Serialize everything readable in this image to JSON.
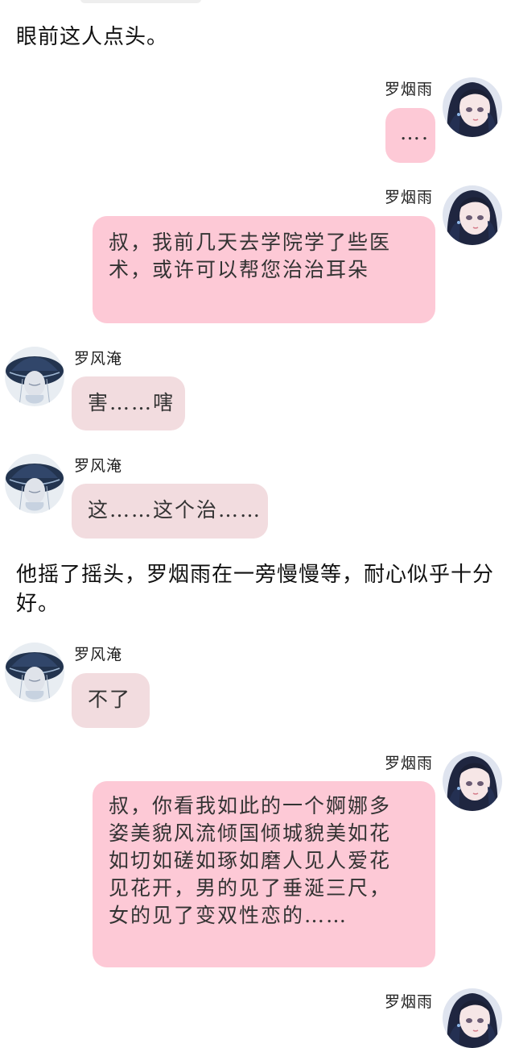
{
  "narration_1": "眼前这人点头。",
  "narration_2": "他摇了摇头，罗烟雨在一旁慢慢等，耐心似乎十分好。",
  "messages": [
    {
      "sender": "罗烟雨",
      "side": "right",
      "text": "…."
    },
    {
      "sender": "罗烟雨",
      "side": "right",
      "text": "叔，我前几天去学院学了些医术，或许可以帮您治治耳朵"
    },
    {
      "sender": "罗风淹",
      "side": "left",
      "text": "害……嗐"
    },
    {
      "sender": "罗风淹",
      "side": "left",
      "text": "这……这个治……"
    },
    {
      "sender": "罗风淹",
      "side": "left",
      "text": "不了"
    },
    {
      "sender": "罗烟雨",
      "side": "right",
      "text": "叔，你看我如此的一个婀娜多姿美貌风流倾国倾城貌美如花如切如磋如琢如磨人见人爱花见花开，男的见了垂涎三尺，女的见了变双性恋的……"
    },
    {
      "sender": "罗烟雨",
      "side": "right",
      "text": ""
    }
  ],
  "avatars": {
    "girl": "avatar-girl-icon",
    "boy": "avatar-hat-icon"
  },
  "colors": {
    "right_bubble": "#fdc9d6",
    "left_bubble": "#f2dcdf",
    "background": "#ffffff"
  }
}
